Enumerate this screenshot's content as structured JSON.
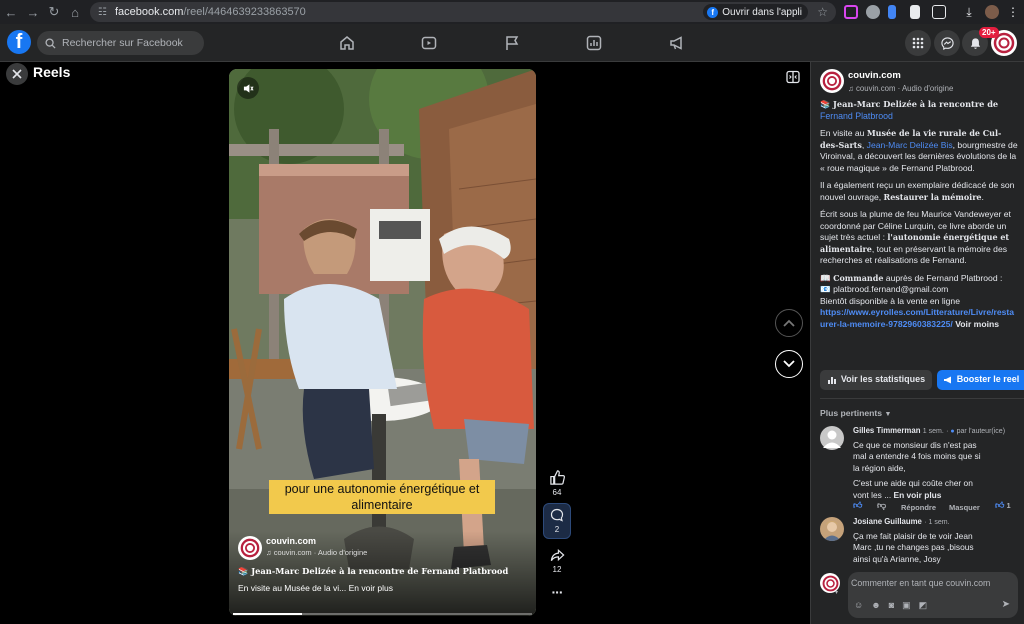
{
  "browser": {
    "url_host": "facebook.com",
    "url_path": "/reel/4464639233863570",
    "open_in_app": "Ouvrir dans l'appli"
  },
  "facebook": {
    "search_placeholder": "Rechercher sur Facebook",
    "notif_count": "20+"
  },
  "reel": {
    "title": "Reels",
    "caption_line1": "pour une autonomie énergétique et",
    "caption_line2": "alimentaire",
    "page_name": "couvin.com",
    "audio": "couvin.com · Audio d'origine",
    "headline": "📚 Jean-Marc Delizée à la rencontre de Fernand Platbrood",
    "snippet": "En visite au Musée de la vi...",
    "see_more": "En voir plus",
    "likes": "64",
    "comments": "2",
    "shares": "12"
  },
  "panel": {
    "page_name": "couvin.com",
    "audio": "couvin.com · Audio d'origine",
    "headline_a": "📚 Jean-Marc Delizée à la rencontre de",
    "headline_b": "Fernand Platbrood",
    "p1_a": "En visite au ",
    "p1_b": "Musée de la vie rurale de Cul-des-Sarts",
    "p1_c": ", ",
    "p1_link": "Jean-Marc Delizée Bis",
    "p1_d": ", bourgmestre de Viroinval, a découvert les dernières évolutions de la « roue magique » de Fernand Platbrood.",
    "p2_a": "Il a également reçu un exemplaire dédicacé de son nouvel ouvrage, ",
    "p2_b": "Restaurer la mémoire",
    "p2_c": ".",
    "p3_a": "Écrit sous la plume de feu Maurice Vandeweyer et coordonné par Céline Lurquin, ce livre aborde un sujet très actuel : ",
    "p3_b": "l'autonomie énergétique et alimentaire",
    "p3_c": ", tout en préservant la mémoire des recherches et réalisations de Fernand.",
    "p4_a": "📖 ",
    "p4_b": "Commande",
    "p4_c": " auprès de Fernand Platbrood :",
    "p4_email": "📧 platbrood.fernand@gmail.com",
    "p4_avail": "Bientôt disponible à la vente en ligne",
    "p4_link": "https://www.eyrolles.com/Litterature/Livre/restaurer-la-memoire-9782960383225/",
    "p4_more": "Voir moins",
    "stats_btn": "Voir les statistiques",
    "boost_btn": "Booster le reel",
    "sort": "Plus pertinents",
    "comment_placeholder": "Commenter en tant que couvin.com"
  },
  "comments": [
    {
      "name": "Gilles Timmerman",
      "time": "1 sem.",
      "by_author": "par l'auteur(ice)",
      "lines": [
        "Ce que ce monsieur dis n'est pas",
        "mal a entendre 4 fois moins que si",
        "la région aide,",
        "C'est une aide qui coûte cher on",
        "vont les ..."
      ],
      "more": "En voir plus",
      "reply": "Répondre",
      "hide": "Masquer",
      "reactions": "1"
    },
    {
      "name": "Josiane Guillaume",
      "time": "1 sem.",
      "lines": [
        "Ça me fait plaisir de te voir Jean",
        "Marc ,tu ne changes pas ,bisous",
        "ainsi qu'à Arianne, Josy"
      ]
    }
  ],
  "colors": {
    "accent": "#1877f2",
    "link": "#4e8cf5",
    "caption_bg": "#f2c94c",
    "panel_bg": "#242526"
  }
}
